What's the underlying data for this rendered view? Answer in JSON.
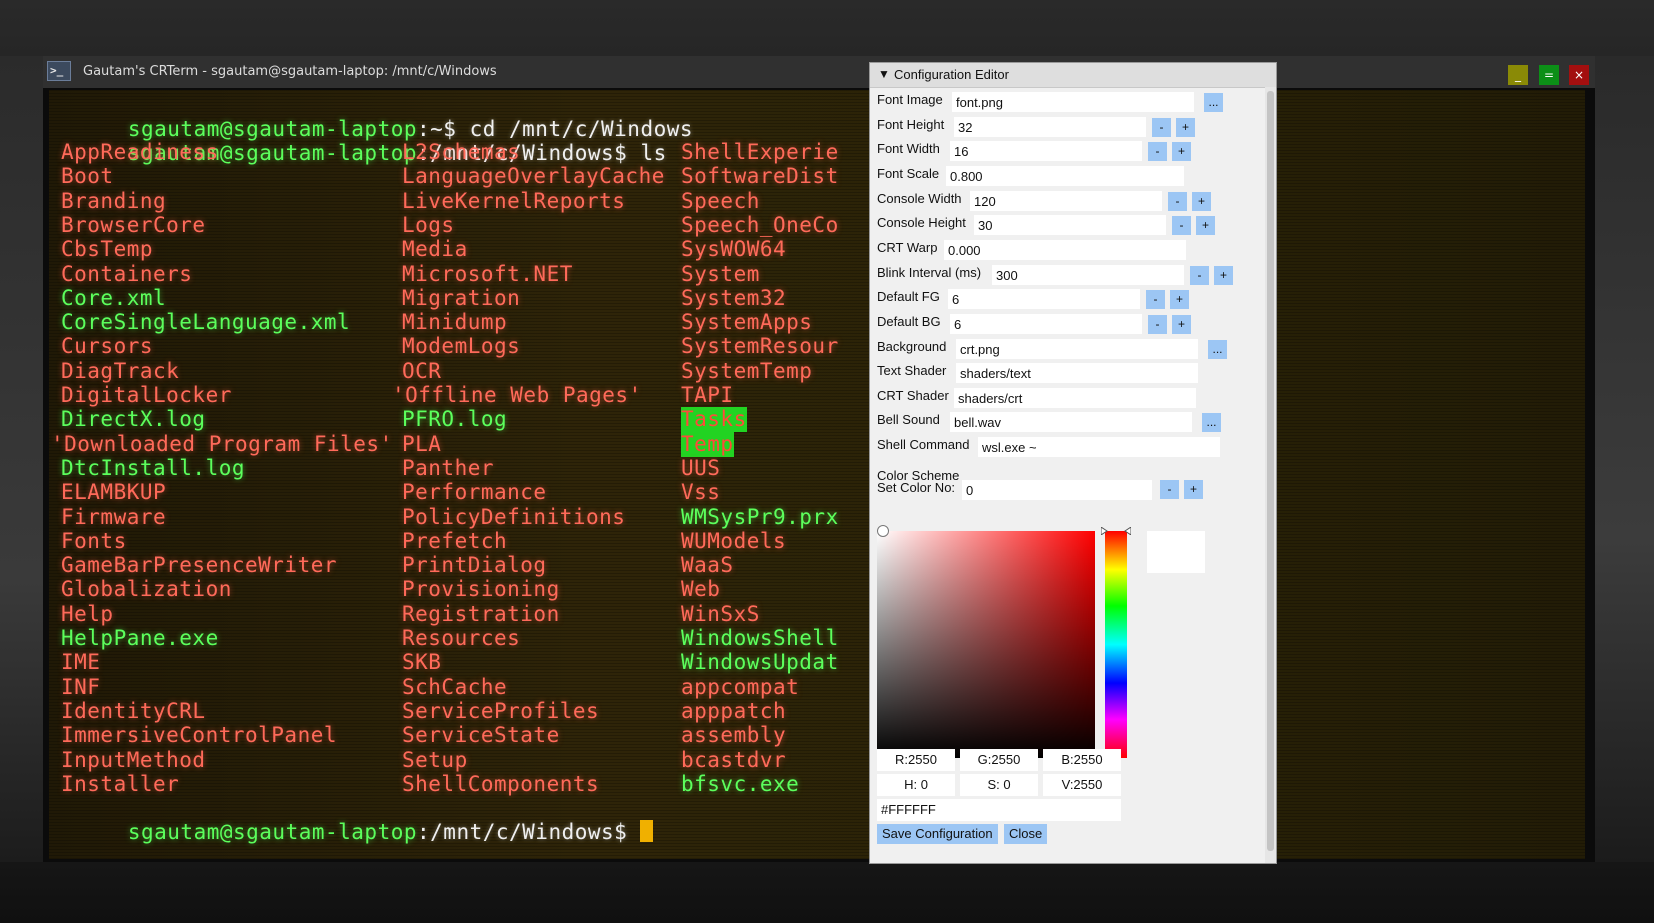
{
  "window": {
    "title": "Gautam's CRTerm - sgautam@sgautam-laptop: /mnt/c/Windows",
    "icon": ">_",
    "minimize_label": "_",
    "maximize_label": "=",
    "close_label": "×"
  },
  "terminal": {
    "lines": [
      {
        "prompt": "sgautam@sgautam-laptop",
        "path": ":~$ ",
        "command": "cd /mnt/c/Windows"
      },
      {
        "prompt": "sgautam@sgautam-laptop",
        "path": ":/mnt/c/Windows$ ",
        "command": "ls"
      }
    ],
    "columns": [
      [
        {
          "name": "AppReadiness",
          "color": "red"
        },
        {
          "name": "Boot",
          "color": "red"
        },
        {
          "name": "Branding",
          "color": "red"
        },
        {
          "name": "BrowserCore",
          "color": "red"
        },
        {
          "name": "CbsTemp",
          "color": "red"
        },
        {
          "name": "Containers",
          "color": "red"
        },
        {
          "name": "Core.xml",
          "color": "green"
        },
        {
          "name": "CoreSingleLanguage.xml",
          "color": "green"
        },
        {
          "name": "Cursors",
          "color": "red"
        },
        {
          "name": "DiagTrack",
          "color": "red"
        },
        {
          "name": "DigitalLocker",
          "color": "red"
        },
        {
          "name": "DirectX.log",
          "color": "green"
        },
        {
          "name": "'Downloaded Program Files'",
          "color": "red"
        },
        {
          "name": "DtcInstall.log",
          "color": "green"
        },
        {
          "name": "ELAMBKUP",
          "color": "red"
        },
        {
          "name": "Firmware",
          "color": "red"
        },
        {
          "name": "Fonts",
          "color": "red"
        },
        {
          "name": "GameBarPresenceWriter",
          "color": "red"
        },
        {
          "name": "Globalization",
          "color": "red"
        },
        {
          "name": "Help",
          "color": "red"
        },
        {
          "name": "HelpPane.exe",
          "color": "green"
        },
        {
          "name": "IME",
          "color": "red"
        },
        {
          "name": "INF",
          "color": "red"
        },
        {
          "name": "IdentityCRL",
          "color": "red"
        },
        {
          "name": "ImmersiveControlPanel",
          "color": "red"
        },
        {
          "name": "InputMethod",
          "color": "red"
        },
        {
          "name": "Installer",
          "color": "red"
        }
      ],
      [
        {
          "name": "L2Schemas",
          "color": "red"
        },
        {
          "name": "LanguageOverlayCache",
          "color": "red"
        },
        {
          "name": "LiveKernelReports",
          "color": "red"
        },
        {
          "name": "Logs",
          "color": "red"
        },
        {
          "name": "Media",
          "color": "red"
        },
        {
          "name": "Microsoft.NET",
          "color": "red"
        },
        {
          "name": "Migration",
          "color": "red"
        },
        {
          "name": "Minidump",
          "color": "red"
        },
        {
          "name": "ModemLogs",
          "color": "red"
        },
        {
          "name": "OCR",
          "color": "red"
        },
        {
          "name": "'Offline Web Pages'",
          "color": "red"
        },
        {
          "name": "PFRO.log",
          "color": "green"
        },
        {
          "name": "PLA",
          "color": "red"
        },
        {
          "name": "Panther",
          "color": "red"
        },
        {
          "name": "Performance",
          "color": "red"
        },
        {
          "name": "PolicyDefinitions",
          "color": "red"
        },
        {
          "name": "Prefetch",
          "color": "red"
        },
        {
          "name": "PrintDialog",
          "color": "red"
        },
        {
          "name": "Provisioning",
          "color": "red"
        },
        {
          "name": "Registration",
          "color": "red"
        },
        {
          "name": "Resources",
          "color": "red"
        },
        {
          "name": "SKB",
          "color": "red"
        },
        {
          "name": "SchCache",
          "color": "red"
        },
        {
          "name": "ServiceProfiles",
          "color": "red"
        },
        {
          "name": "ServiceState",
          "color": "red"
        },
        {
          "name": "Setup",
          "color": "red"
        },
        {
          "name": "ShellComponents",
          "color": "red"
        }
      ],
      [
        {
          "name": "ShellExperie",
          "color": "red"
        },
        {
          "name": "SoftwareDist",
          "color": "red"
        },
        {
          "name": "Speech",
          "color": "red"
        },
        {
          "name": "Speech_OneCo",
          "color": "red"
        },
        {
          "name": "SysWOW64",
          "color": "red"
        },
        {
          "name": "System",
          "color": "red"
        },
        {
          "name": "System32",
          "color": "red"
        },
        {
          "name": "SystemApps",
          "color": "red"
        },
        {
          "name": "SystemResour",
          "color": "red"
        },
        {
          "name": "SystemTemp",
          "color": "red"
        },
        {
          "name": "TAPI",
          "color": "red"
        },
        {
          "name": "Tasks",
          "color": "highlight"
        },
        {
          "name": "Temp",
          "color": "highlight"
        },
        {
          "name": "UUS",
          "color": "red"
        },
        {
          "name": "Vss",
          "color": "red"
        },
        {
          "name": "WMSysPr9.prx",
          "color": "green"
        },
        {
          "name": "WUModels",
          "color": "red"
        },
        {
          "name": "WaaS",
          "color": "red"
        },
        {
          "name": "Web",
          "color": "red"
        },
        {
          "name": "WinSxS",
          "color": "red"
        },
        {
          "name": "WindowsShell",
          "color": "green"
        },
        {
          "name": "WindowsUpdat",
          "color": "green"
        },
        {
          "name": "appcompat",
          "color": "red"
        },
        {
          "name": "apppatch",
          "color": "red"
        },
        {
          "name": "assembly",
          "color": "red"
        },
        {
          "name": "bcastdvr",
          "color": "red"
        },
        {
          "name": "bfsvc.exe",
          "color": "green"
        }
      ]
    ],
    "final_prompt": {
      "prompt": "sgautam@sgautam-laptop",
      "path": ":/mnt/c/Windows$ "
    }
  },
  "config": {
    "title": "Configuration Editor",
    "fields": [
      {
        "label": "Font Image",
        "value": "font.png",
        "kind": "browse"
      },
      {
        "label": "Font Height",
        "value": "32",
        "kind": "stepper"
      },
      {
        "label": "Font Width",
        "value": "16",
        "kind": "stepper"
      },
      {
        "label": "Font Scale",
        "value": "0.800",
        "kind": "text"
      },
      {
        "label": "Console Width",
        "value": "120",
        "kind": "stepper"
      },
      {
        "label": "Console Height",
        "value": "30",
        "kind": "stepper"
      },
      {
        "label": "CRT Warp",
        "value": "0.000",
        "kind": "text"
      },
      {
        "label": "Blink Interval (ms)",
        "value": "300",
        "kind": "stepper"
      },
      {
        "label": "Default FG",
        "value": "6",
        "kind": "stepper"
      },
      {
        "label": "Default BG",
        "value": "6",
        "kind": "stepper"
      },
      {
        "label": "Background",
        "value": "crt.png",
        "kind": "browse"
      },
      {
        "label": "Text Shader",
        "value": "shaders/text",
        "kind": "text"
      },
      {
        "label": "CRT Shader",
        "value": "shaders/crt",
        "kind": "text"
      },
      {
        "label": "Bell Sound",
        "value": "bell.wav",
        "kind": "browse"
      },
      {
        "label": "Shell Command",
        "value": "wsl.exe ~",
        "kind": "text"
      }
    ],
    "color_scheme_label": "Color Scheme",
    "set_color": {
      "label": "Set Color No:",
      "value": "0"
    },
    "button_minus": "-",
    "button_plus": "+",
    "button_browse": "...",
    "picker": {
      "hue_color": "#ff0000",
      "selected_hex": "#FFFFFF",
      "r": "R:2550",
      "g": "G:2550",
      "b": "B:2550",
      "h": "H:  0",
      "s": "S:  0",
      "v": "V:2550"
    },
    "save_label": "Save Configuration",
    "close_label": "Close"
  }
}
